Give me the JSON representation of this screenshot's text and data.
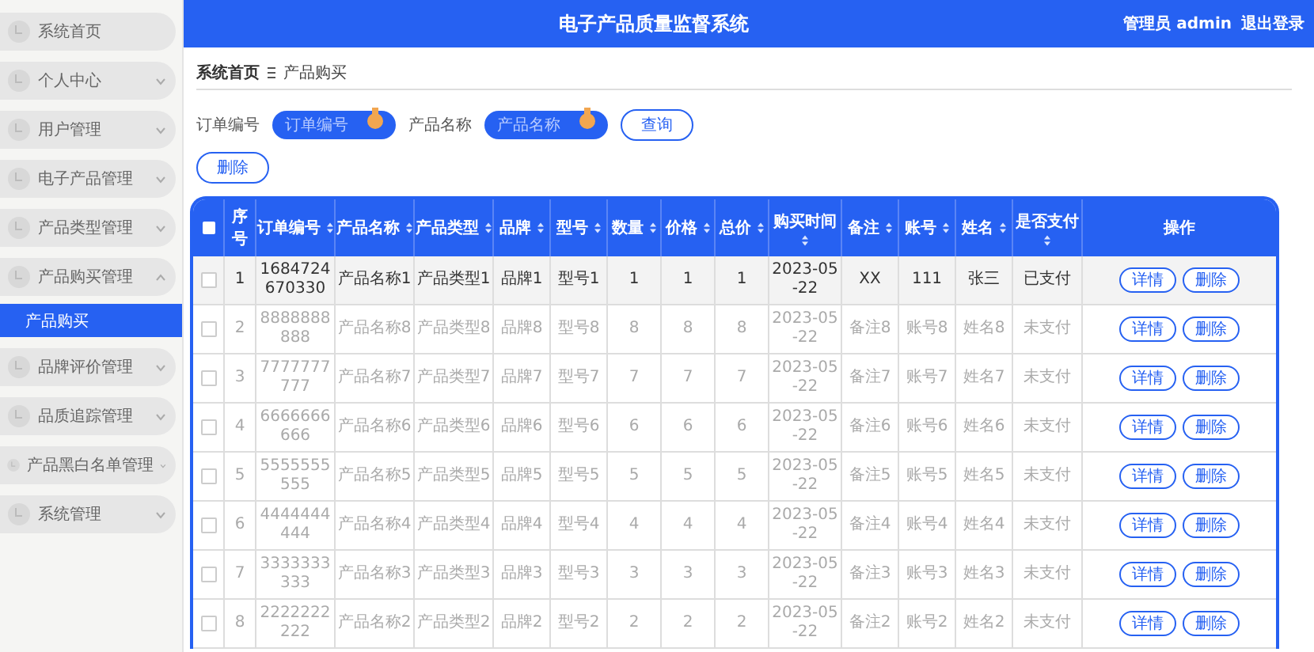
{
  "header": {
    "title": "电子产品质量监督系统",
    "user": "管理员 admin",
    "logout": "退出登录"
  },
  "sidebar": {
    "items": [
      {
        "label": "系统首页",
        "kind": "link"
      },
      {
        "label": "个人中心",
        "kind": "group",
        "expanded": false
      },
      {
        "label": "用户管理",
        "kind": "group",
        "expanded": false
      },
      {
        "label": "电子产品管理",
        "kind": "group",
        "expanded": false
      },
      {
        "label": "产品类型管理",
        "kind": "group",
        "expanded": false
      },
      {
        "label": "产品购买管理",
        "kind": "group",
        "expanded": true,
        "children": [
          {
            "label": "产品购买",
            "selected": true
          }
        ]
      },
      {
        "label": "品牌评价管理",
        "kind": "group",
        "expanded": false
      },
      {
        "label": "品质追踪管理",
        "kind": "group",
        "expanded": false
      },
      {
        "label": "产品黑白名单管理",
        "kind": "group",
        "expanded": false
      },
      {
        "label": "系统管理",
        "kind": "group",
        "expanded": false
      }
    ]
  },
  "breadcrumb": [
    "系统首页",
    "产品购买"
  ],
  "search": {
    "fields": [
      {
        "label": "订单编号",
        "placeholder": "订单编号"
      },
      {
        "label": "产品名称",
        "placeholder": "产品名称"
      }
    ],
    "button": "查询"
  },
  "delete_button": "删除",
  "table": {
    "select_all_checked": false,
    "columns": [
      {
        "label": "序号",
        "sortable": false
      },
      {
        "label": "订单编号",
        "sortable": true
      },
      {
        "label": "产品名称",
        "sortable": true
      },
      {
        "label": "产品类型",
        "sortable": true
      },
      {
        "label": "品牌",
        "sortable": true
      },
      {
        "label": "型号",
        "sortable": true
      },
      {
        "label": "数量",
        "sortable": true
      },
      {
        "label": "价格",
        "sortable": true
      },
      {
        "label": "总价",
        "sortable": true
      },
      {
        "label": "购买时间",
        "sortable": true
      },
      {
        "label": "备注",
        "sortable": true
      },
      {
        "label": "账号",
        "sortable": true
      },
      {
        "label": "姓名",
        "sortable": true
      },
      {
        "label": "是否支付",
        "sortable": true
      },
      {
        "label": "操作",
        "sortable": false
      }
    ],
    "rows": [
      {
        "highlighted": true,
        "cells": [
          "1",
          "1684724670330",
          "产品名称1",
          "产品类型1",
          "品牌1",
          "型号1",
          "1",
          "1",
          "1",
          "2023-05-22",
          "XX",
          "111",
          "张三",
          "已支付"
        ],
        "actions": [
          "详情",
          "删除"
        ]
      },
      {
        "highlighted": false,
        "cells": [
          "2",
          "8888888888",
          "产品名称8",
          "产品类型8",
          "品牌8",
          "型号8",
          "8",
          "8",
          "8",
          "2023-05-22",
          "备注8",
          "账号8",
          "姓名8",
          "未支付"
        ],
        "actions": [
          "详情",
          "删除"
        ]
      },
      {
        "highlighted": false,
        "cells": [
          "3",
          "7777777777",
          "产品名称7",
          "产品类型7",
          "品牌7",
          "型号7",
          "7",
          "7",
          "7",
          "2023-05-22",
          "备注7",
          "账号7",
          "姓名7",
          "未支付"
        ],
        "actions": [
          "详情",
          "删除"
        ]
      },
      {
        "highlighted": false,
        "cells": [
          "4",
          "6666666666",
          "产品名称6",
          "产品类型6",
          "品牌6",
          "型号6",
          "6",
          "6",
          "6",
          "2023-05-22",
          "备注6",
          "账号6",
          "姓名6",
          "未支付"
        ],
        "actions": [
          "详情",
          "删除"
        ]
      },
      {
        "highlighted": false,
        "cells": [
          "5",
          "5555555555",
          "产品名称5",
          "产品类型5",
          "品牌5",
          "型号5",
          "5",
          "5",
          "5",
          "2023-05-22",
          "备注5",
          "账号5",
          "姓名5",
          "未支付"
        ],
        "actions": [
          "详情",
          "删除"
        ]
      },
      {
        "highlighted": false,
        "cells": [
          "6",
          "4444444444",
          "产品名称4",
          "产品类型4",
          "品牌4",
          "型号4",
          "4",
          "4",
          "4",
          "2023-05-22",
          "备注4",
          "账号4",
          "姓名4",
          "未支付"
        ],
        "actions": [
          "详情",
          "删除"
        ]
      },
      {
        "highlighted": false,
        "cells": [
          "7",
          "3333333333",
          "产品名称3",
          "产品类型3",
          "品牌3",
          "型号3",
          "3",
          "3",
          "3",
          "2023-05-22",
          "备注3",
          "账号3",
          "姓名3",
          "未支付"
        ],
        "actions": [
          "详情",
          "删除"
        ]
      },
      {
        "highlighted": false,
        "cells": [
          "8",
          "2222222222",
          "产品名称2",
          "产品类型2",
          "品牌2",
          "型号2",
          "2",
          "2",
          "2",
          "2023-05-22",
          "备注2",
          "账号2",
          "姓名2",
          "未支付"
        ],
        "actions": [
          "详情",
          "删除"
        ]
      }
    ]
  }
}
